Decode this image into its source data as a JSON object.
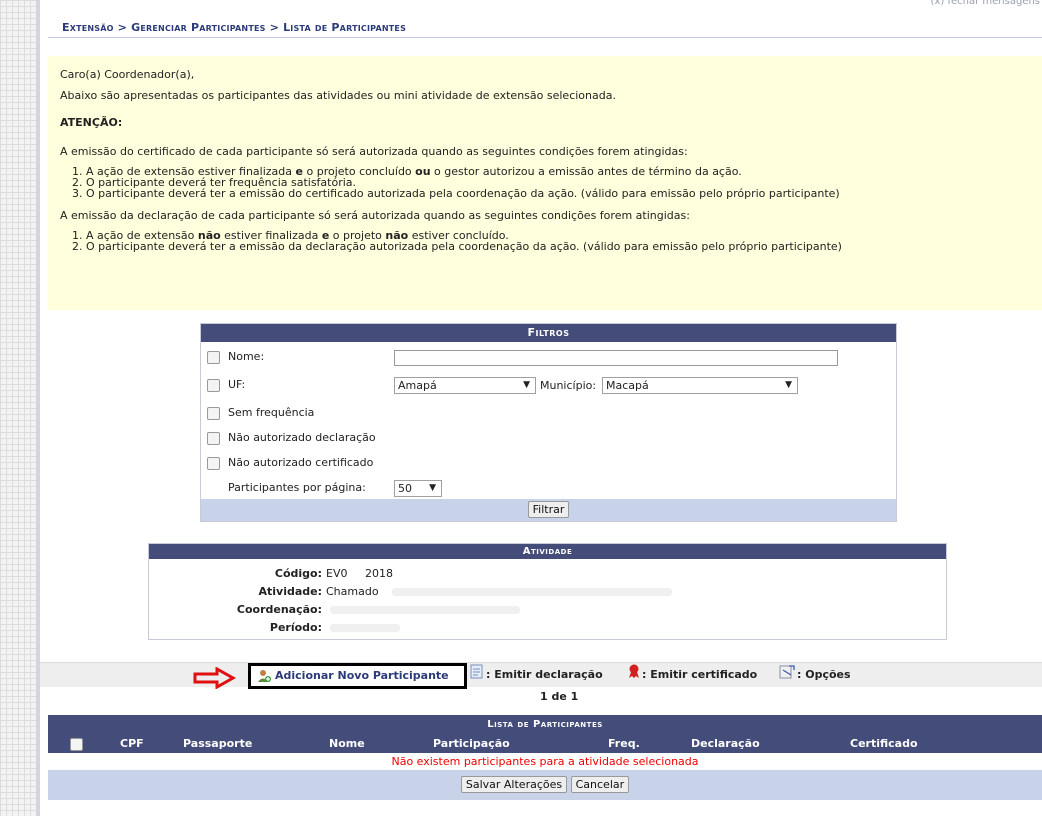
{
  "close_message": "(x) fechar mensagens",
  "breadcrumb": "Extensão > Gerenciar Participantes > Lista de Participantes",
  "message": {
    "greeting": "Caro(a) Coordenador(a),",
    "intro": "Abaixo são apresentadas os participantes das atividades ou mini atividade de extensão selecionada.",
    "attention": "ATENÇÃO:",
    "cert_intro": "A emissão do certificado de cada participante só será autorizada quando as seguintes condições forem atingidas:",
    "cert_1a": "A ação de extensão estiver finalizada ",
    "cert_1b": "e",
    "cert_1c": " o projeto concluído ",
    "cert_1d": "ou",
    "cert_1e": " o gestor autorizou a emissão antes de término da ação.",
    "cert_2": "O participante deverá ter frequência satisfatória.",
    "cert_3": "O participante deverá ter a emissão do certificado autorizada pela coordenação da ação. (válido para emissão pelo próprio participante)",
    "decl_intro": "A emissão da declaração de cada participante só será autorizada quando as seguintes condições forem atingidas:",
    "decl_1a": "A ação de extensão ",
    "decl_1b": "não",
    "decl_1c": " estiver finalizada ",
    "decl_1d": "e",
    "decl_1e": " o projeto ",
    "decl_1f": "não",
    "decl_1g": " estiver concluído.",
    "decl_2": "O participante deverá ter a emissão da declaração autorizada pela coordenação da ação. (válido para emissão pelo próprio participante)"
  },
  "filters": {
    "title": "Filtros",
    "nome_label": "Nome:",
    "nome_value": "",
    "uf_label": "UF:",
    "uf_value": "Amapá",
    "municipio_label": "Município:",
    "municipio_value": "Macapá",
    "sem_freq": "Sem frequência",
    "nao_aut_decl": "Não autorizado declaração",
    "nao_aut_cert": "Não autorizado certificado",
    "por_pagina_label": "Participantes por página:",
    "por_pagina_value": "50",
    "filter_button": "Filtrar"
  },
  "activity": {
    "title": "Atividade",
    "codigo_label": "Código:",
    "codigo_value": "EV0     2018",
    "atividade_label": "Atividade:",
    "atividade_value": "Chamado",
    "coordenacao_label": "Coordenação:",
    "periodo_label": "Período:"
  },
  "options": {
    "add_participant": "Adicionar Novo Participante",
    "emitir_declaracao": ": Emitir declaração",
    "emitir_certificado": ": Emitir certificado",
    "opcoes": ": Opções",
    "pagination": "1 de 1"
  },
  "participants": {
    "title": "Lista de Participantes",
    "columns": [
      "CPF",
      "Passaporte",
      "Nome",
      "Participação",
      "Freq.",
      "Declaração",
      "Certificado"
    ],
    "empty_message": "Não existem participantes para a atividade selecionada",
    "save_button": "Salvar Alterações",
    "cancel_button": "Cancelar"
  },
  "colors": {
    "header_bg": "#444c7a",
    "message_bg": "#ffffdd",
    "footer_bg": "#c8d3ea",
    "error_text": "#e00000",
    "arrow_red": "#e01010"
  }
}
